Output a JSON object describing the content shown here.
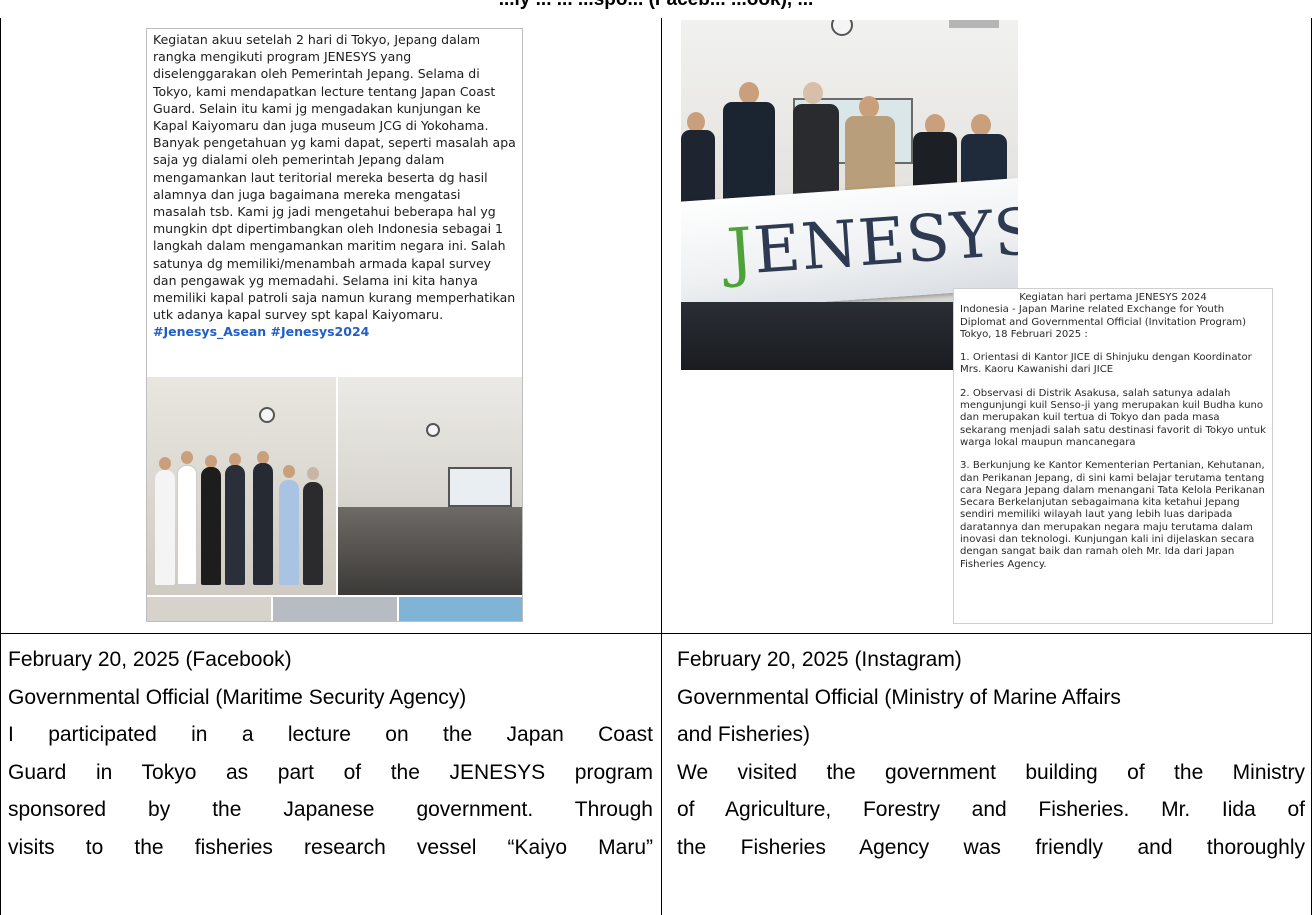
{
  "header": {
    "partial_heading": "...ly ... ... ...spo... (Faceb... ...ook), ..."
  },
  "left_post": {
    "body": "Kegiatan akuu setelah 2 hari di Tokyo, Jepang dalam rangka mengikuti program JENESYS yang diselenggarakan oleh Pemerintah Jepang. Selama di Tokyo, kami mendapatkan lecture tentang Japan Coast Guard. Selain itu kami jg mengadakan kunjungan ke Kapal Kaiyomaru dan juga museum JCG di Yokohama. Banyak pengetahuan yg kami dapat, seperti masalah apa saja yg dialami oleh pemerintah Jepang dalam mengamankan laut teritorial mereka beserta dg hasil alamnya dan juga bagaimana mereka mengatasi masalah tsb. Kami jg jadi mengetahui beberapa hal yg mungkin dpt dipertimbangkan oleh Indonesia sebagai 1 langkah dalam mengamankan maritim negara ini. Salah satunya dg memiliki/menambah armada kapal survey dan pengawak yg memadahi. Selama ini kita hanya memiliki kapal patroli saja namun kurang memperhatikan utk adanya kapal survey spt kapal Kaiyomaru.",
    "hashtags": "#Jenesys_Asean #Jenesys2024"
  },
  "right_photo": {
    "banner_j": "J",
    "banner_rest": "ENESYS"
  },
  "right_caption": {
    "title": "Kegiatan hari pertama JENESYS 2024",
    "intro": "Indonesia - Japan Marine related Exchange for Youth Diplomat and Governmental Official (Invitation Program) Tokyo, 18 Februari 2025 :",
    "item1": "1. Orientasi di Kantor JICE di Shinjuku dengan Koordinator Mrs. Kaoru Kawanishi dari JICE",
    "item2": "2. Observasi di Distrik Asakusa, salah satunya adalah mengunjungi kuil Senso-ji yang merupakan kuil Budha kuno dan merupakan kuil tertua di Tokyo dan pada masa sekarang menjadi salah satu destinasi favorit di Tokyo untuk warga lokal maupun mancanegara",
    "item3": "3. Berkunjung ke Kantor Kementerian Pertanian, Kehutanan, dan Perikanan Jepang, di sini kami belajar terutama tentang cara Negara Jepang dalam menangani Tata Kelola Perikanan Secara Berkelanjutan sebagaimana kita ketahui Jepang sendiri memiliki wilayah laut yang lebih luas daripada daratannya dan merupakan negara maju terutama dalam inovasi dan teknologi. Kunjungan kali ini dijelaskan secara dengan sangat baik dan ramah oleh Mr. Ida dari Japan Fisheries Agency."
  },
  "left_cell": {
    "line1": "February 20, 2025 (Facebook)",
    "line2": "Governmental Official (Maritime Security Agency)",
    "line3": "I participated in a lecture on the Japan Coast",
    "line4": "Guard in Tokyo as part of the JENESYS program",
    "line5": "sponsored by the Japanese government. Through",
    "line6": "visits to the fisheries research vessel “Kaiyo Maru”"
  },
  "right_cell": {
    "line1": "February 20, 2025 (Instagram)",
    "line2": "Governmental Official (Ministry of Marine Affairs",
    "line3": "and Fisheries)",
    "line4": "We visited the government building of the Ministry",
    "line5": "of Agriculture, Forestry and Fisheries. Mr. Iida of",
    "line6": "the Fisheries Agency was friendly and thoroughly"
  }
}
